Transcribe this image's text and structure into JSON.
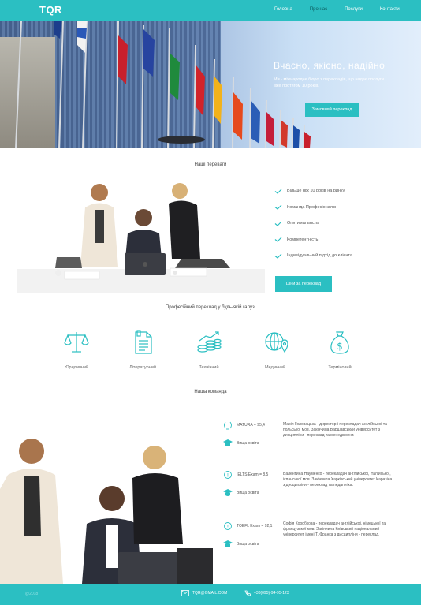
{
  "header": {
    "logo": "TQR",
    "nav": [
      "Головна",
      "Про нас",
      "Послуги",
      "Контакти"
    ],
    "active_nav": "Про нас"
  },
  "hero": {
    "title": "Вчасно, якісно, надійно",
    "subtitle": "Ми - міжнародне бюро з перекладів, що надає послуги вже протягом 10 років.",
    "button": "Замовляй переклад"
  },
  "advantages": {
    "title": "Наші переваги",
    "items": [
      "Більше ніж 10 років на ринку",
      "Команда Професіоналів",
      "Опитимальнсть",
      "Компетентність",
      "Індивідуальний підхід до клієнта"
    ],
    "button": "Ціни за переклад"
  },
  "industries": {
    "title": "Професійний переклад у будь-якій галузі",
    "items": [
      {
        "label": "Юридичний",
        "icon": "scales-icon"
      },
      {
        "label": "Літературний",
        "icon": "document-icon"
      },
      {
        "label": "Технічний",
        "icon": "coins-icon"
      },
      {
        "label": "Медичний",
        "icon": "globe-icon"
      },
      {
        "label": "Терміновий",
        "icon": "money-bag-icon"
      }
    ]
  },
  "team": {
    "title": "Наша команда",
    "members": [
      {
        "cert": "MATURA = 95,4",
        "edu": "Вища освіта",
        "desc": "Марія Головацька - директор і перекладач англійської та польської мов. Закінчила Варшавський університет з дисципліни - переклад та менеджмент."
      },
      {
        "cert": "IELTS Exam = 8,5",
        "edu": "Вища освіта",
        "desc": "Валентина Науменко - перекладач англійської, італійської, іспанської мов. Закінчила Харківський університет Каразіна з дисципліни - переклад та педагогіка."
      },
      {
        "cert": "TOEFL Exam = 92,1",
        "edu": "Вища освіта",
        "desc": "Софія Коробкова - перекладач англійської, німецької та французької мов. Закінчила Київський національний університет імені Т. Франка з дисципліни - переклад."
      }
    ]
  },
  "footer": {
    "copyright": "@2018",
    "email": "TQR@GMAIL.COM",
    "phone": "+38(095)-94-95-123"
  },
  "colors": {
    "accent": "#2bbfc2"
  }
}
